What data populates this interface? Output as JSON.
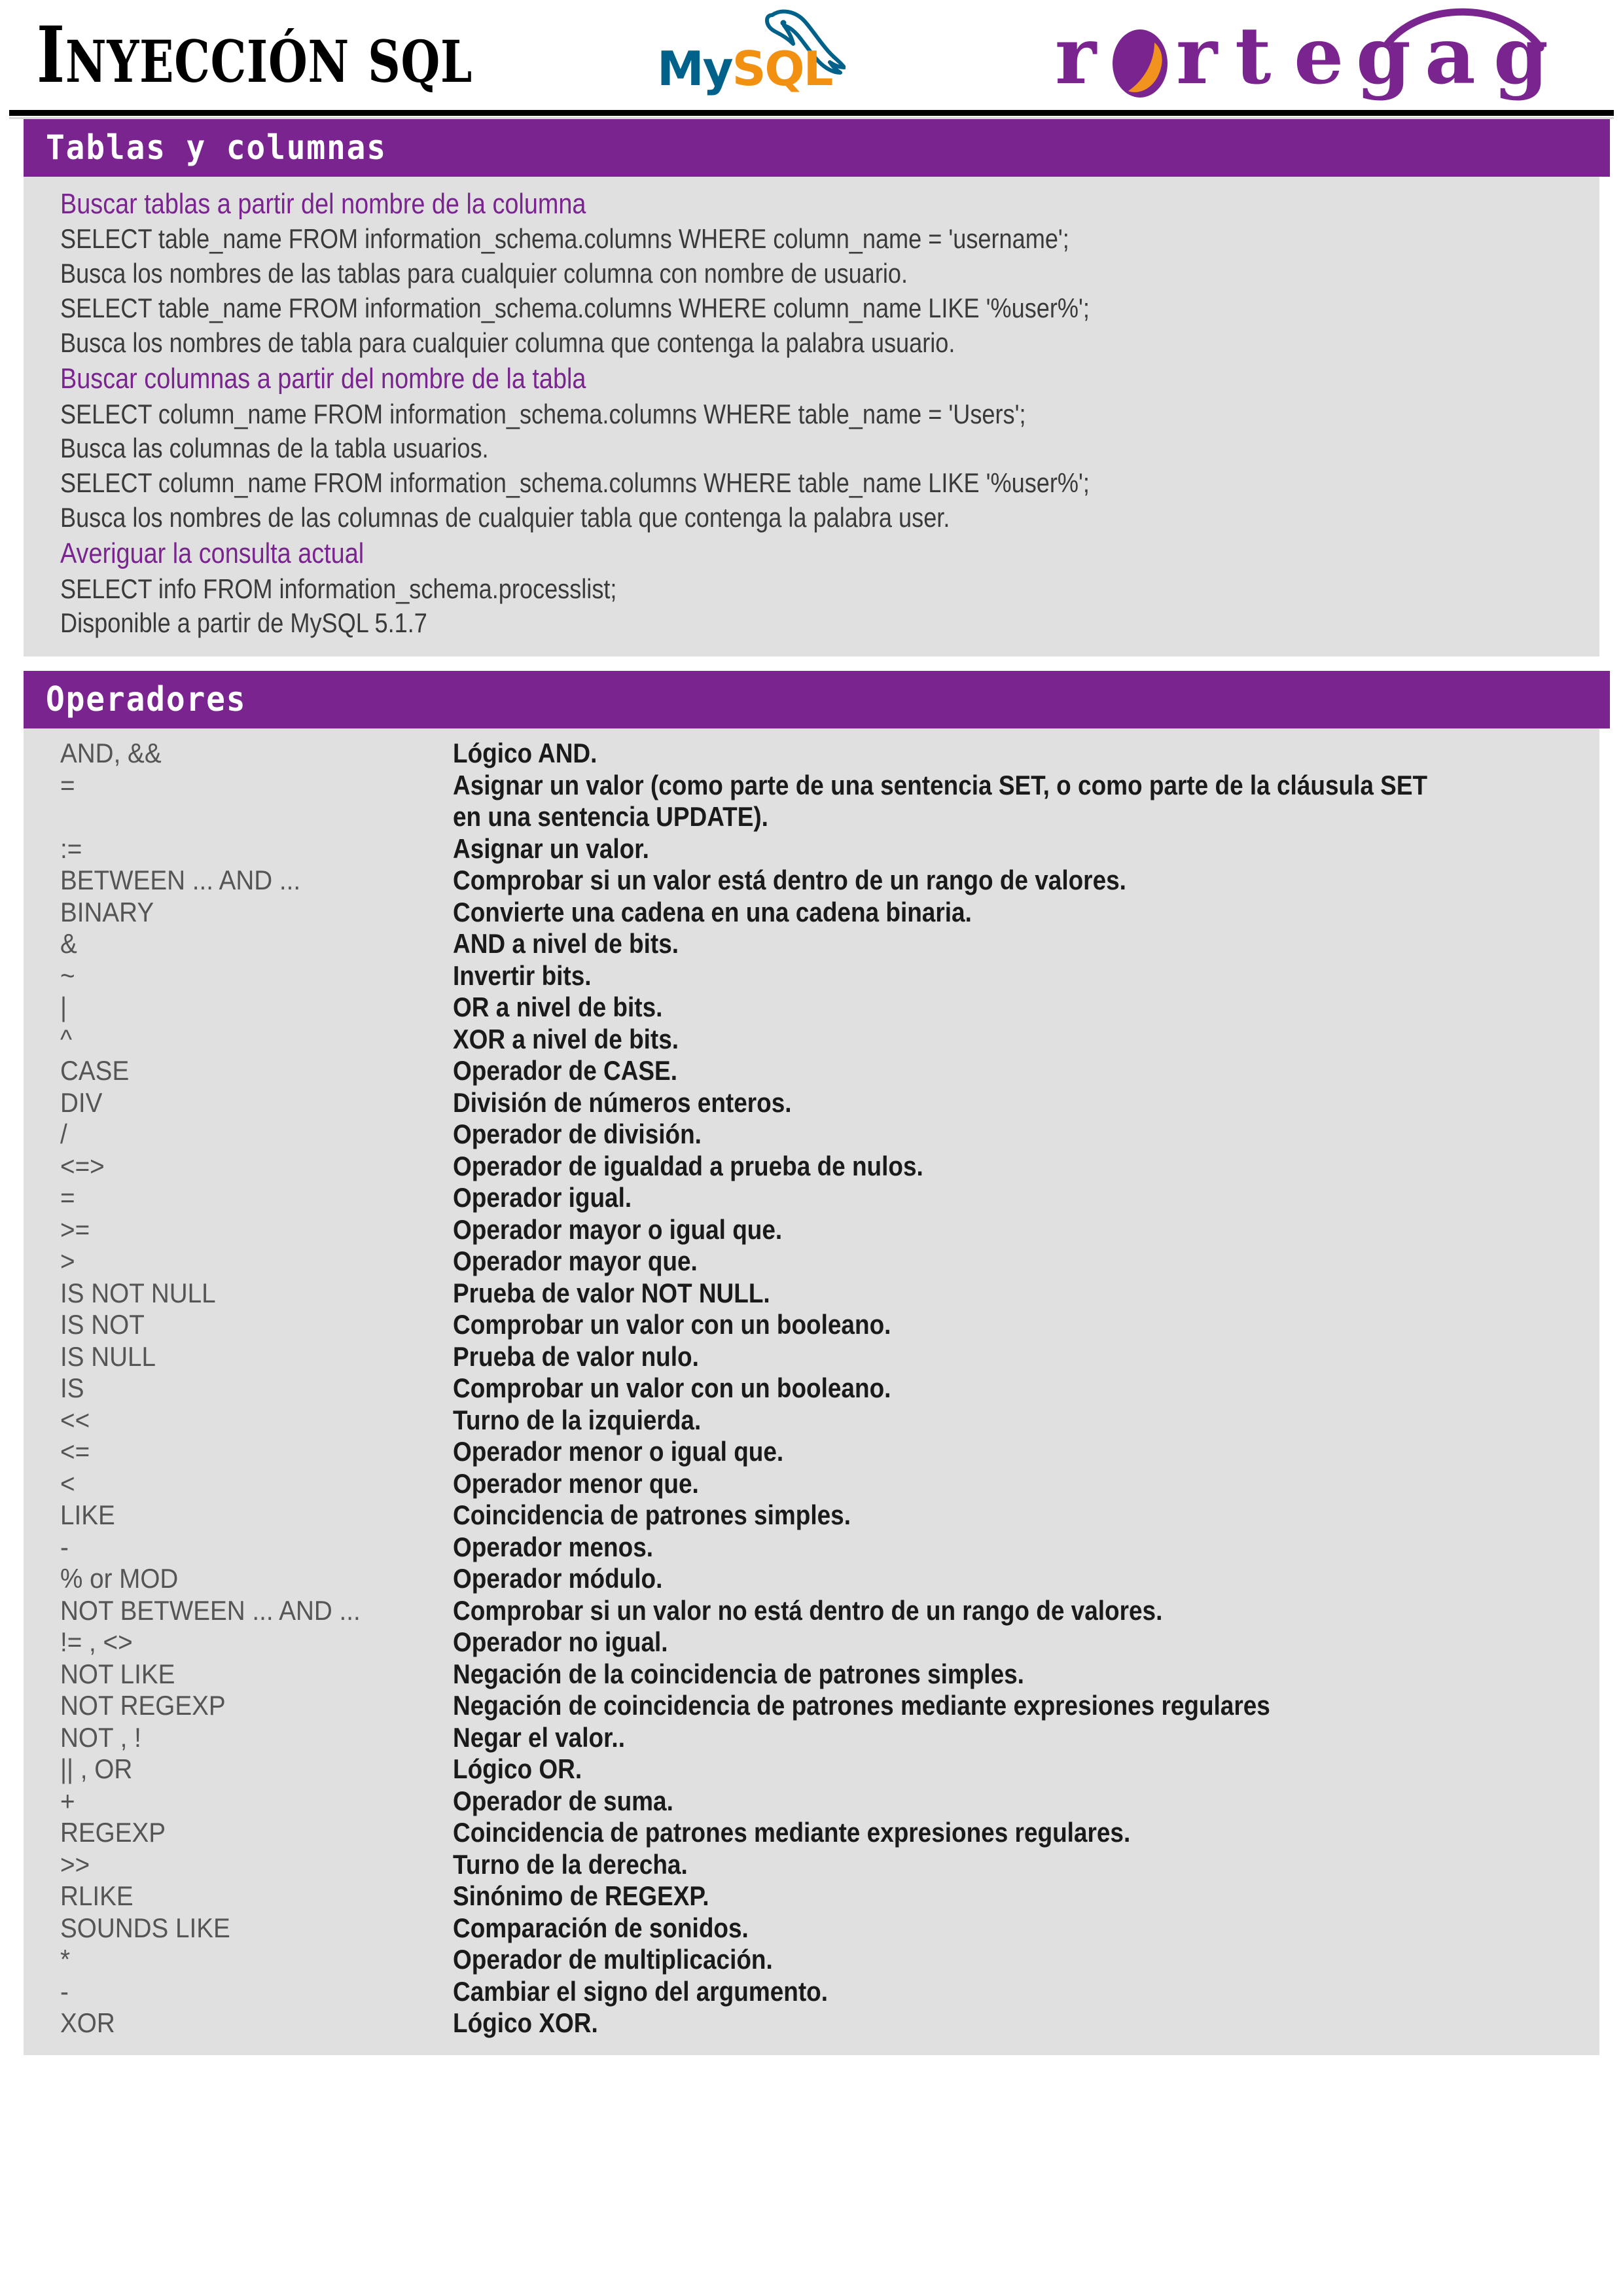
{
  "header": {
    "title_cap": "I",
    "title_rest": "NYECCIÓN",
    "title_tail": "SQL",
    "mysql_my": "My",
    "mysql_sql": "SQL",
    "brand_name": "rortegag",
    "brand_color": "#7A2490",
    "mysql_blue": "#00618A",
    "mysql_orange": "#F29111"
  },
  "sections": [
    {
      "id": "tablas-y-columnas",
      "title": "Tablas y columnas",
      "lines": [
        {
          "kind": "sub",
          "text": "Buscar tablas a partir del nombre de la columna"
        },
        {
          "kind": "code",
          "text": "SELECT table_name FROM information_schema.columns WHERE column_name = 'username';"
        },
        {
          "kind": "code",
          "text": "Busca los nombres de las tablas para cualquier columna con nombre de usuario."
        },
        {
          "kind": "code",
          "text": "SELECT table_name FROM information_schema.columns WHERE column_name LIKE '%user%';"
        },
        {
          "kind": "code",
          "text": "Busca los nombres de tabla para cualquier columna que contenga la palabra usuario."
        },
        {
          "kind": "sub",
          "text": "Buscar columnas a partir del nombre de la tabla"
        },
        {
          "kind": "code",
          "text": "SELECT column_name FROM information_schema.columns WHERE table_name = 'Users';"
        },
        {
          "kind": "code",
          "text": "Busca las columnas de la tabla usuarios."
        },
        {
          "kind": "code",
          "text": "SELECT column_name FROM information_schema.columns WHERE table_name LIKE '%user%';"
        },
        {
          "kind": "code",
          "text": "Busca los nombres de las columnas de cualquier tabla que contenga la palabra user."
        },
        {
          "kind": "sub",
          "text": "Averiguar la consulta actual"
        },
        {
          "kind": "code",
          "text": "SELECT info FROM information_schema.processlist;"
        },
        {
          "kind": "code",
          "text": "Disponible a partir de MySQL 5.1.7"
        }
      ]
    },
    {
      "id": "operadores",
      "title": "Operadores",
      "rows": [
        {
          "op": "AND, &&",
          "desc": "Lógico AND."
        },
        {
          "op": "=",
          "desc": "Asignar un valor (como parte de una sentencia SET, o como parte de la cláusula SET en una sentencia UPDATE)."
        },
        {
          "op": ":=",
          "desc": "Asignar un valor."
        },
        {
          "op": "BETWEEN ... AND ...",
          "desc": "Comprobar si un valor está dentro de un rango de valores."
        },
        {
          "op": "BINARY",
          "desc": "Convierte una cadena en una cadena binaria."
        },
        {
          "op": "&",
          "desc": "AND a nivel de bits."
        },
        {
          "op": "~",
          "desc": "Invertir bits."
        },
        {
          "op": "|",
          "desc": "OR a nivel de bits."
        },
        {
          "op": "^",
          "desc": "XOR a nivel de bits."
        },
        {
          "op": "CASE",
          "desc": "Operador de CASE."
        },
        {
          "op": "DIV",
          "desc": "División de números enteros."
        },
        {
          "op": "/",
          "desc": "Operador de división."
        },
        {
          "op": "<=>",
          "desc": "Operador de igualdad a prueba de nulos."
        },
        {
          "op": "=",
          "desc": "Operador igual."
        },
        {
          "op": ">=",
          "desc": "Operador mayor o igual que."
        },
        {
          "op": ">",
          "desc": "Operador mayor que."
        },
        {
          "op": "IS NOT NULL",
          "desc": "Prueba de valor NOT NULL."
        },
        {
          "op": "IS NOT",
          "desc": "Comprobar un valor con un booleano."
        },
        {
          "op": "IS NULL",
          "desc": "Prueba de valor nulo."
        },
        {
          "op": "IS",
          "desc": "Comprobar un valor con un booleano."
        },
        {
          "op": "<<",
          "desc": "Turno de la izquierda."
        },
        {
          "op": "<=",
          "desc": "Operador menor o igual que."
        },
        {
          "op": "<",
          "desc": "Operador menor que."
        },
        {
          "op": "LIKE",
          "desc": "Coincidencia de patrones simples."
        },
        {
          "op": "-",
          "desc": "Operador menos."
        },
        {
          "op": "% or MOD",
          "desc": "Operador módulo."
        },
        {
          "op": "NOT BETWEEN ... AND ...",
          "desc": "Comprobar si un valor no está dentro de un rango de valores."
        },
        {
          "op": "!= , <>",
          "desc": "Operador no igual."
        },
        {
          "op": "NOT LIKE",
          "desc": "Negación de la coincidencia de patrones simples."
        },
        {
          "op": "NOT REGEXP",
          "desc": "Negación de coincidencia de patrones mediante expresiones regulares"
        },
        {
          "op": "NOT , !",
          "desc": "Negar el valor.."
        },
        {
          "op": "|| , OR",
          "desc": "Lógico OR."
        },
        {
          "op": "+",
          "desc": "Operador de suma."
        },
        {
          "op": "REGEXP",
          "desc": "Coincidencia de patrones mediante expresiones regulares."
        },
        {
          "op": ">>",
          "desc": "Turno de la derecha."
        },
        {
          "op": "RLIKE",
          "desc": "Sinónimo de REGEXP."
        },
        {
          "op": "SOUNDS LIKE",
          "desc": "Comparación de sonidos."
        },
        {
          "op": "*",
          "desc": "Operador de multiplicación."
        },
        {
          "op": "-",
          "desc": "Cambiar el signo del argumento."
        },
        {
          "op": "XOR",
          "desc": "Lógico XOR."
        }
      ]
    }
  ]
}
